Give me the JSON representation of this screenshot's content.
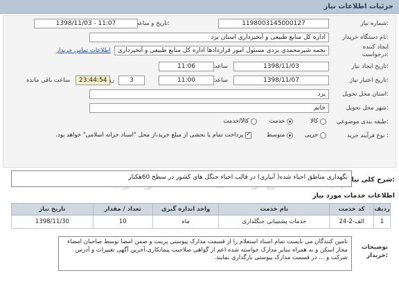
{
  "header": {
    "title": "جزئیات اطلاعات نیاز"
  },
  "fields": {
    "need_number_label": "شماره نیاز:",
    "need_number": "1198003145000127",
    "announce_label": "تاریخ و ساعت اعلان عمومی:",
    "announce_value": "1398/11/03 - 11:07",
    "buyer_label": "نام دستگاه خریدار:",
    "buyer_value": "اداره کل منابع طبیعی و آبخیزداری استان یزد",
    "creator_label_1": "ایجاد کننده",
    "creator_label_2": "درخواست:",
    "creator_value": "نجمه شیرمحمدی یزدی مسئول امور قراردادها  اداره کل منابع طبیعی و آبخیزداری",
    "contact_link": "اطلاعات تماس خریدار",
    "created_date_label": "تاریخ ایجاد نیاز:",
    "created_date": "1398/11/03",
    "time_label_1": "ساعت",
    "created_time": "11:06",
    "deadline_label": "تاریخ اعتبار نیاز:",
    "deadline_date": "1398/11/07",
    "time_label_2": "ساعت",
    "deadline_time": "11:00",
    "days_value": "3",
    "days_label": "روز و",
    "remaining_time": "23:44:54",
    "remaining_label": "ساعت باقی مانده",
    "province_label": "استان محل تحویل:",
    "province_value": "یزد",
    "city_label": "شهر محل تحویل:",
    "city_value": "خاتم",
    "category_label": "طبقه بندی موضوعی:",
    "category_options": [
      "کالا",
      "خدمت",
      "کالا/خدمت"
    ],
    "purchase_label": "نوع فرآیند خرید :",
    "purchase_options": [
      "جزیی",
      "متوسط"
    ],
    "payment_note": "پرداخت تمام یا بخشی از مبلغ خرید،از محل \"اسناد خزانه اسلامی\" خواهد بود."
  },
  "summary": {
    "label": "شرح کلی نیاز:",
    "text": "نگهداری مناطق احیاء شده( آبیاری) در قالب احیاء جنگل های کشور  در سطح 60هکتار"
  },
  "services": {
    "title": "اطلاعات خدمات مورد نیاز",
    "columns": [
      "ردیف",
      "کد خدمت",
      "نام خدمت",
      "واحد اندازه گیری",
      "تعداد / مقدار",
      "تاریخ نیاز"
    ],
    "rows": [
      {
        "index": "1",
        "code": "الف-2-24",
        "name": "خدمات پشتیبانی جنگلداری",
        "unit": "ماه",
        "qty": "10",
        "date": "1398/11/30"
      }
    ]
  },
  "buyer_notes": {
    "label_1": "توضیحات",
    "label_2": "خریدار:",
    "text": "تامین کنندگان می بایست تمام اسناد استعلام را از قسمت مدارک پیوستی پرینت و ضمن امضا توسط صاحبان امضاء مجاز اسکن و به همراه سایر مدارک خواسته شده اعم از گواهی صلاحیت پیمانکاری،آخرین آگهی تغییرات و آدرس شرکت و ... در قسمت مدارک پیوستی بارگذاری نمایند."
  },
  "watermark": {
    "line1": "پایگاه اطلاع رسانی مناقصه و مزایده",
    "line2": "۰۲۱-۸۸۳۴۹۶۷۰"
  }
}
